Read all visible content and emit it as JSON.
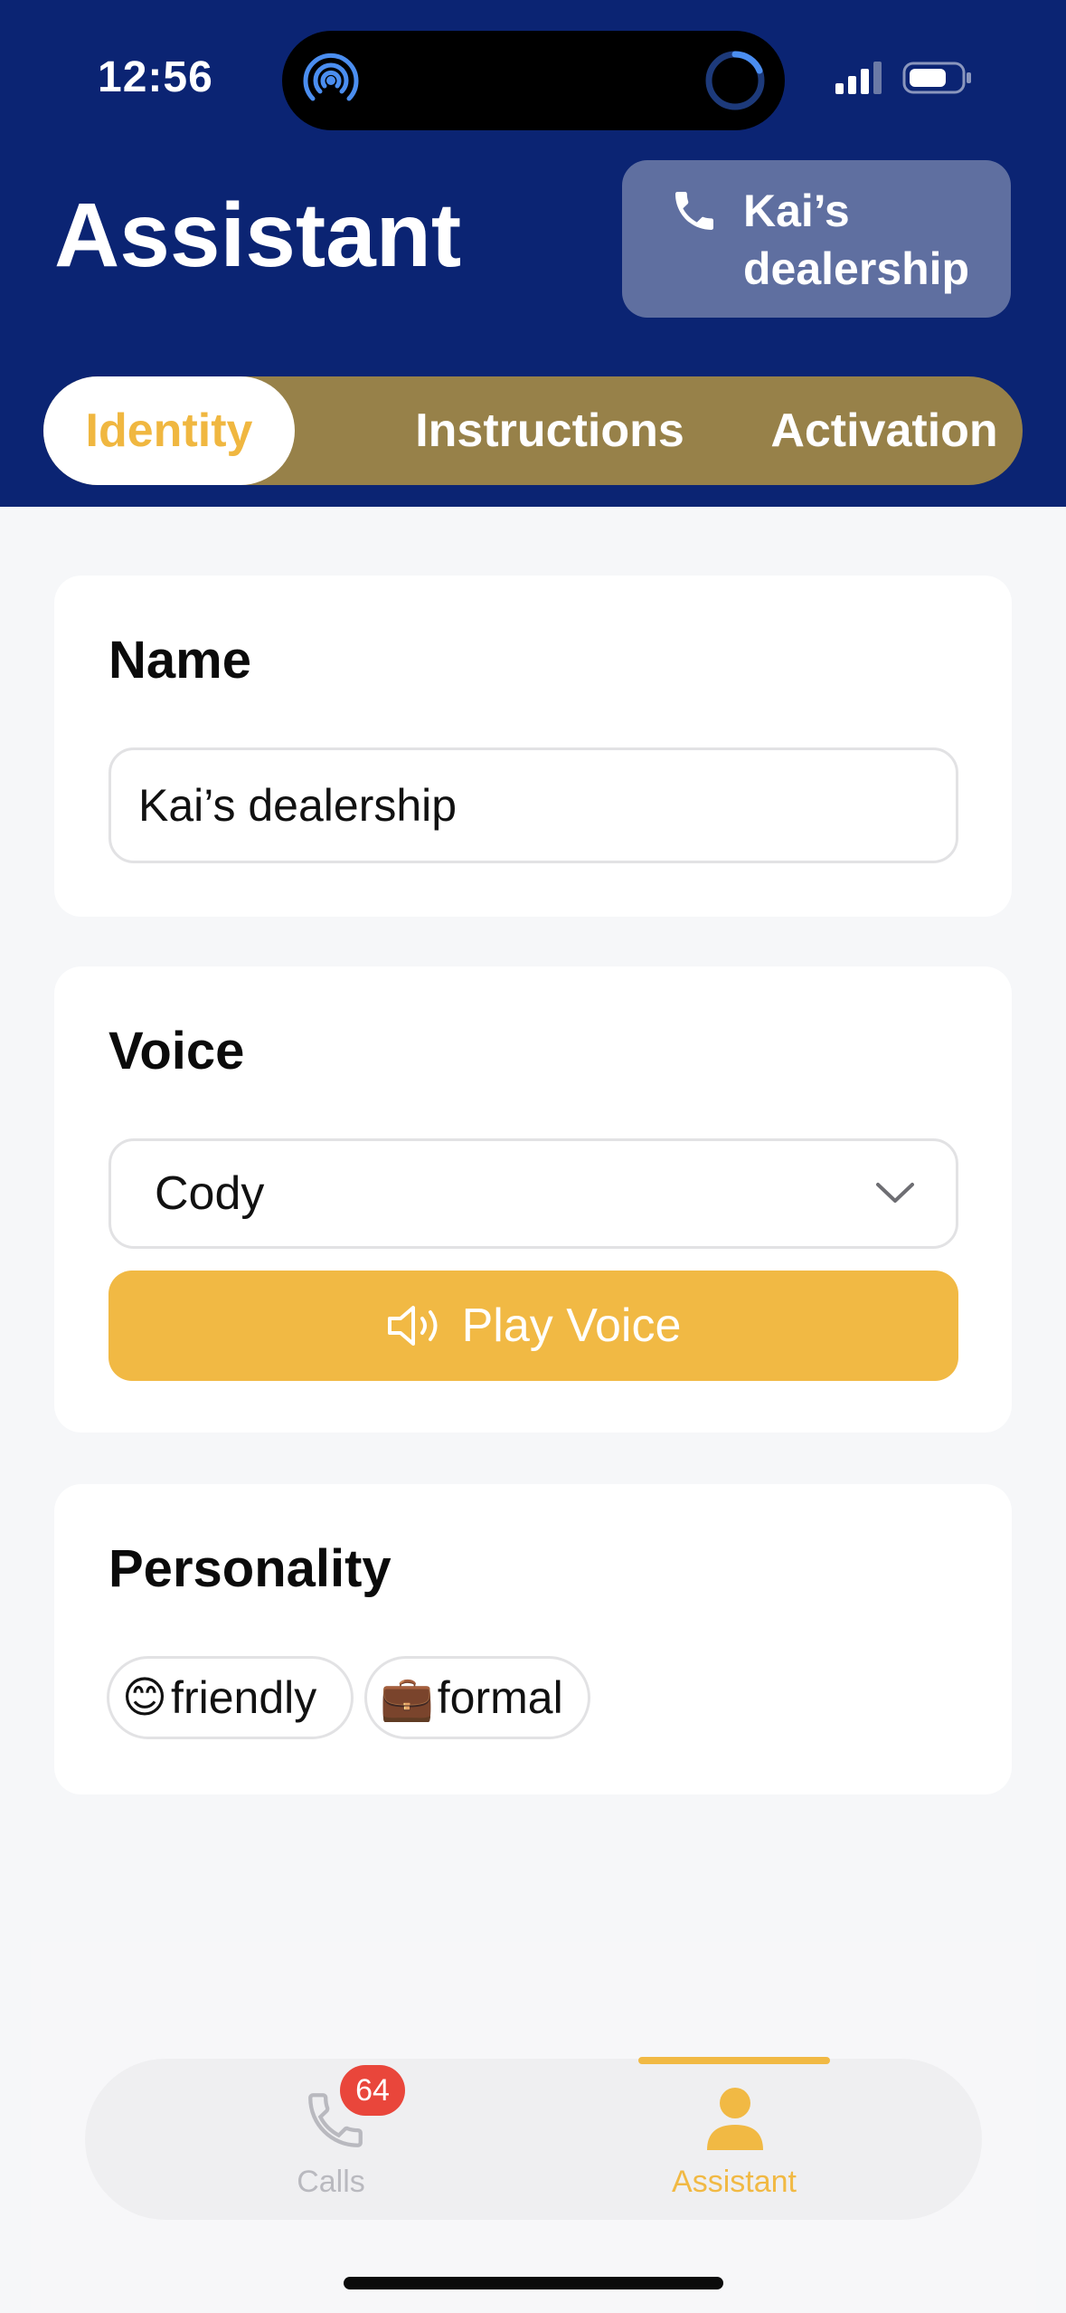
{
  "status_bar": {
    "time": "12:56"
  },
  "header": {
    "title": "Assistant",
    "phone_chip": {
      "label": "Kai’s dealership",
      "icon": "phone-icon"
    }
  },
  "tabs": [
    {
      "label": "Identity",
      "active": true
    },
    {
      "label": "Instructions",
      "active": false
    },
    {
      "label": "Activation",
      "active": false
    }
  ],
  "name_section": {
    "title": "Name",
    "value": "Kai’s dealership"
  },
  "voice_section": {
    "title": "Voice",
    "selected": "Cody",
    "play_label": "Play Voice",
    "play_icon": "speaker-icon"
  },
  "personality_section": {
    "title": "Personality",
    "chips": [
      {
        "emoji": "😊",
        "label": "friendly"
      },
      {
        "emoji": "💼",
        "label": "formal"
      }
    ]
  },
  "tab_bar": {
    "calls": {
      "label": "Calls",
      "badge": "64",
      "icon": "phone-icon"
    },
    "assistant": {
      "label": "Assistant",
      "icon": "person-icon",
      "active": true
    }
  },
  "colors": {
    "header_bg": "#0b2473",
    "accent": "#f1b944",
    "segment_bg": "#978149",
    "badge": "#e9463b"
  }
}
